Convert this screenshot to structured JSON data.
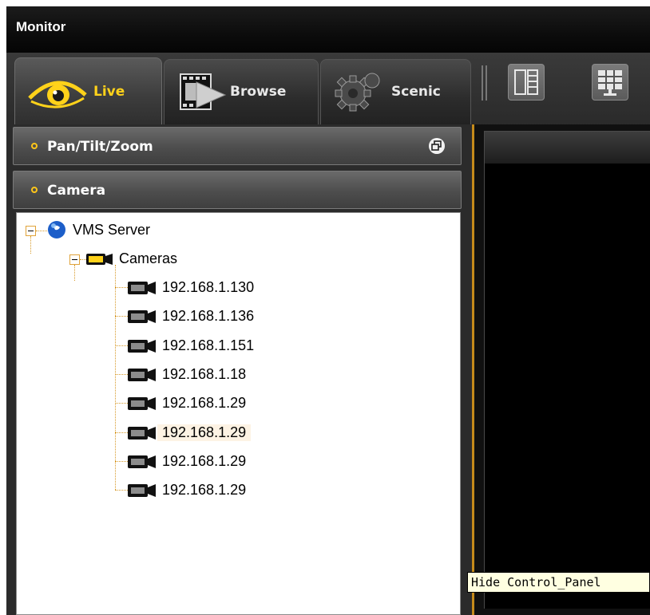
{
  "window": {
    "title": "Monitor"
  },
  "tabs": [
    {
      "label": "Live",
      "icon": "eye-icon",
      "active": true
    },
    {
      "label": "Browse",
      "icon": "film-play-icon",
      "active": false
    },
    {
      "label": "Scenic",
      "icon": "gear-icon",
      "active": false
    }
  ],
  "toolbar": [
    {
      "icon": "split-layout-icon"
    },
    {
      "icon": "monitor-grid-icon"
    }
  ],
  "panels": {
    "ptz": {
      "label": "Pan/Tilt/Zoom",
      "icon": "float-window-icon"
    },
    "camera": {
      "label": "Camera"
    }
  },
  "tree": {
    "server": "VMS Server",
    "group": "Cameras",
    "cameras": [
      "192.168.1.130",
      "192.168.1.136",
      "192.168.1.151",
      "192.168.1.18",
      "192.168.1.29",
      "192.168.1.29",
      "192.168.1.29",
      "192.168.1.29"
    ],
    "selected_index": 5
  },
  "tooltip": "Hide Control_Panel",
  "colors": {
    "accent": "#ffc619",
    "selection": "#fdf3e4",
    "divider": "#c48a1a"
  }
}
